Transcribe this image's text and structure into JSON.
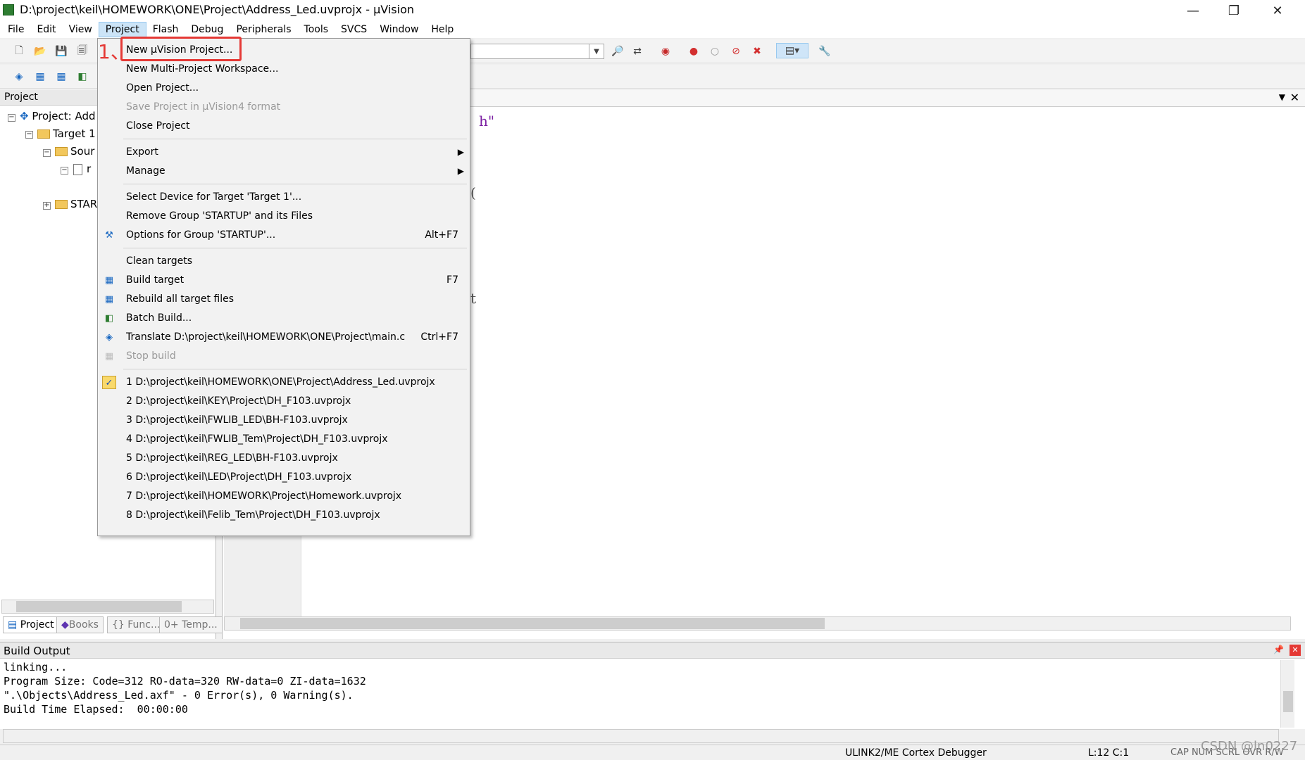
{
  "window": {
    "title": "D:\\project\\keil\\HOMEWORK\\ONE\\Project\\Address_Led.uvprojx - µVision",
    "minimize": "—",
    "restore": "❐",
    "close": "✕"
  },
  "menubar": [
    "File",
    "Edit",
    "View",
    "Project",
    "Flash",
    "Debug",
    "Peripherals",
    "Tools",
    "SVCS",
    "Window",
    "Help"
  ],
  "project_panel": {
    "header": "Project",
    "tree": {
      "root": "Project: Add",
      "target": "Target 1",
      "group1": "Sour",
      "file": "r",
      "group2": "STAR"
    },
    "tabs": [
      "Project",
      "Books",
      "{} Func...",
      "0+ Temp..."
    ]
  },
  "editor": {
    "fragments": [
      "h\"",
      "(",
      "t"
    ]
  },
  "project_menu": {
    "annotation": "1、",
    "items": [
      {
        "label": "New µVision Project...",
        "shortcut": "",
        "disabled": false
      },
      {
        "label": "New Multi-Project Workspace...",
        "shortcut": "",
        "disabled": false
      },
      {
        "label": "Open Project...",
        "shortcut": "",
        "disabled": false
      },
      {
        "label": "Save Project in µVision4 format",
        "shortcut": "",
        "disabled": true
      },
      {
        "label": "Close Project",
        "shortcut": "",
        "disabled": false
      },
      {
        "label": "Export",
        "shortcut": "",
        "submenu": true
      },
      {
        "label": "Manage",
        "shortcut": "",
        "submenu": true
      },
      {
        "label": "Select Device for Target 'Target 1'...",
        "shortcut": ""
      },
      {
        "label": "Remove Group 'STARTUP' and its Files",
        "shortcut": ""
      },
      {
        "label": "Options for Group 'STARTUP'...",
        "shortcut": "Alt+F7"
      },
      {
        "label": "Clean targets",
        "shortcut": ""
      },
      {
        "label": "Build target",
        "shortcut": "F7"
      },
      {
        "label": "Rebuild all target files",
        "shortcut": ""
      },
      {
        "label": "Batch Build...",
        "shortcut": ""
      },
      {
        "label": "Translate D:\\project\\keil\\HOMEWORK\\ONE\\Project\\main.c",
        "shortcut": "Ctrl+F7"
      },
      {
        "label": "Stop build",
        "shortcut": "",
        "disabled": true
      },
      {
        "label": "1 D:\\project\\keil\\HOMEWORK\\ONE\\Project\\Address_Led.uvprojx",
        "checked": true
      },
      {
        "label": "2 D:\\project\\keil\\KEY\\Project\\DH_F103.uvprojx"
      },
      {
        "label": "3 D:\\project\\keil\\FWLIB_LED\\BH-F103.uvprojx"
      },
      {
        "label": "4 D:\\project\\keil\\FWLIB_Tem\\Project\\DH_F103.uvprojx"
      },
      {
        "label": "5 D:\\project\\keil\\REG_LED\\BH-F103.uvprojx"
      },
      {
        "label": "6 D:\\project\\keil\\LED\\Project\\DH_F103.uvprojx"
      },
      {
        "label": "7 D:\\project\\keil\\HOMEWORK\\Project\\Homework.uvprojx"
      },
      {
        "label": "8 D:\\project\\keil\\Felib_Tem\\Project\\DH_F103.uvprojx"
      }
    ]
  },
  "build_output": {
    "header": "Build Output",
    "lines": [
      "linking...",
      "Program Size: Code=312 RO-data=320 RW-data=0 ZI-data=1632",
      "\".\\Objects\\Address_Led.axf\" - 0 Error(s), 0 Warning(s).",
      "Build Time Elapsed:  00:00:00"
    ]
  },
  "statusbar": {
    "debugger": "ULINK2/ME Cortex Debugger",
    "position": "L:12 C:1",
    "indicators": "CAP  NUM  SCRL  OVR  R/W"
  },
  "watermark": "CSDN @ln0227",
  "colors": {
    "highlight": "#e53935",
    "menu_active": "#cce4f7"
  }
}
